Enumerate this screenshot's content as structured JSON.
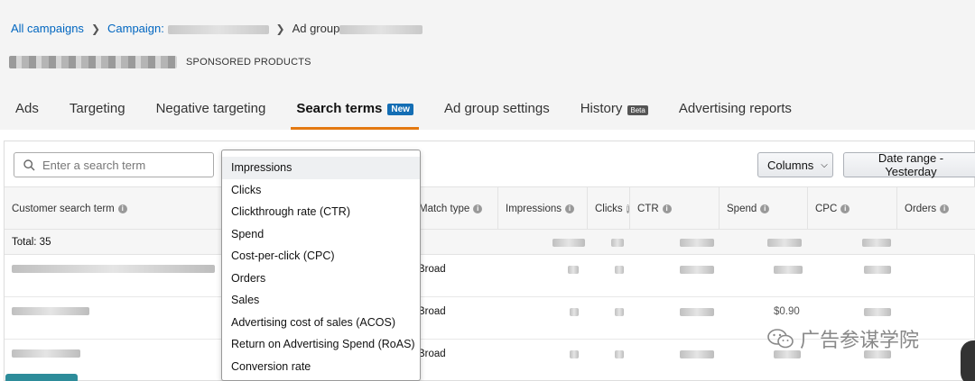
{
  "breadcrumb": {
    "all_campaigns": "All campaigns",
    "campaign": "Campaign:",
    "ad_group": "Ad group"
  },
  "header": {
    "campaign_type": "SPONSORED PRODUCTS"
  },
  "tabs": [
    {
      "label": "Ads"
    },
    {
      "label": "Targeting"
    },
    {
      "label": "Negative targeting"
    },
    {
      "label": "Search terms",
      "badge": "New",
      "active": true
    },
    {
      "label": "Ad group settings"
    },
    {
      "label": "History",
      "badge": "Beta"
    },
    {
      "label": "Advertising reports"
    }
  ],
  "toolbar": {
    "search_placeholder": "Enter a search term",
    "columns_label": "Columns",
    "date_range_label": "Date range - Yesterday"
  },
  "table": {
    "headers": {
      "search_term": "Customer search term",
      "match_type": "Match type",
      "impressions": "Impressions",
      "clicks": "Clicks",
      "ctr": "CTR",
      "spend": "Spend",
      "cpc": "CPC",
      "orders": "Orders"
    },
    "total_label": "Total: 35",
    "rows": [
      {
        "match_type": "Broad"
      },
      {
        "match_type": "Broad",
        "spend": "$0.90"
      },
      {
        "match_type": "Broad"
      }
    ]
  },
  "dropdown": {
    "options": [
      "Impressions",
      "Clicks",
      "Clickthrough rate (CTR)",
      "Spend",
      "Cost-per-click (CPC)",
      "Orders",
      "Sales",
      "Advertising cost of sales (ACOS)",
      "Return on Advertising Spend (RoAS)",
      "Conversion rate"
    ]
  },
  "watermark": {
    "text": "广告参谋学院"
  },
  "colors": {
    "link": "#0066c0",
    "tab_active_underline": "#e47911",
    "badge_new": "#146eb4"
  }
}
